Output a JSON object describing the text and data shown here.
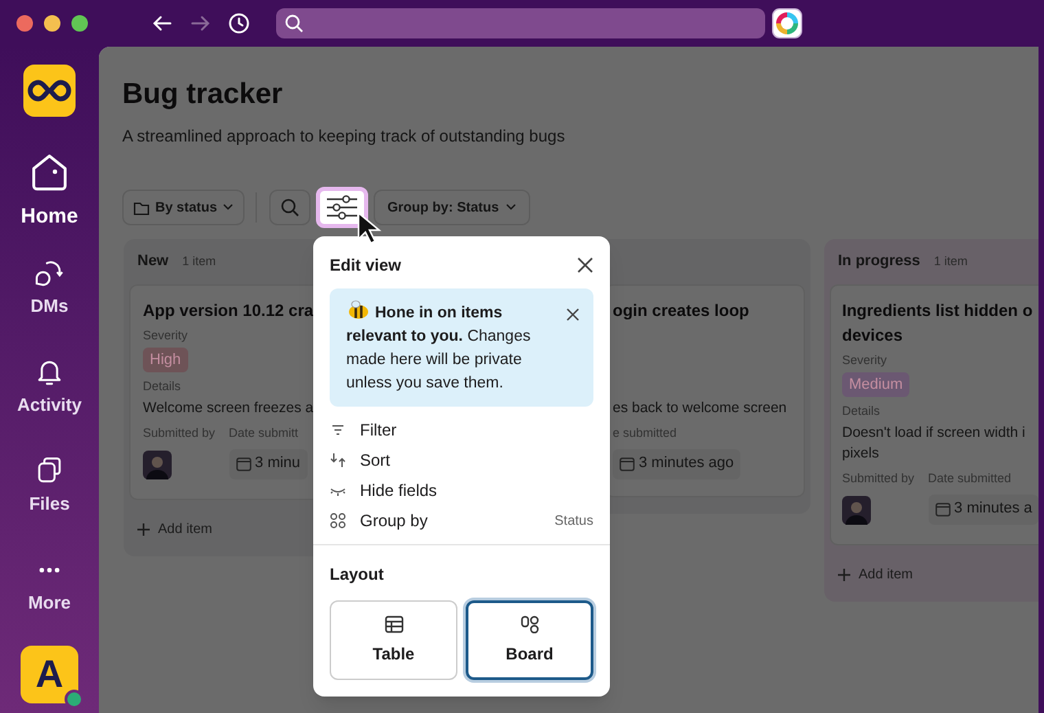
{
  "nav": [
    {
      "kind": "back",
      "disabled": false
    },
    {
      "kind": "forward",
      "disabled": true
    },
    {
      "kind": "history",
      "disabled": false
    }
  ],
  "sidebar": {
    "items": [
      {
        "kind": "home",
        "label": "Home",
        "selected": true
      },
      {
        "kind": "dms",
        "label": "DMs",
        "selected": false
      },
      {
        "kind": "activity",
        "label": "Activity",
        "selected": false
      },
      {
        "kind": "files",
        "label": "Files",
        "selected": false
      },
      {
        "kind": "more",
        "label": "More",
        "selected": false
      }
    ],
    "user_initial": "A",
    "online": true
  },
  "page": {
    "title": "Bug tracker",
    "description": "A streamlined approach to keeping track of outstanding bugs",
    "view_button": "By status",
    "group_button": "Group by: Status"
  },
  "columns": [
    {
      "name": "New",
      "count": "1 item",
      "add_label": "Add item",
      "cards": [
        {
          "title_lines": [
            "App version 10.12 cra"
          ],
          "severity_label": "Severity",
          "severity": {
            "label": "High",
            "color": "#6e5357"
          },
          "details_label": "Details",
          "details_lines": [
            "Welcome screen freezes a"
          ],
          "submitted_label": "Submitted by",
          "date_label": "Date submitt",
          "date": "3 minu"
        }
      ]
    },
    {
      "cards": [
        {
          "title_lines": [
            "ogin creates loop"
          ],
          "details_lines": [
            "es back to welcome screen"
          ],
          "date_label": "e submitted",
          "date": "3 minutes ago"
        }
      ]
    },
    {
      "name": "In progress",
      "count": "1 item",
      "add_label": "Add item",
      "cards": [
        {
          "title_lines": [
            "Ingredients list hidden o",
            "devices"
          ],
          "severity_label": "Severity",
          "severity": {
            "label": "Medium",
            "color": "#6b5872"
          },
          "details_label": "Details",
          "details_lines": [
            "Doesn't load if screen width i",
            "pixels"
          ],
          "submitted_label": "Submitted by",
          "date_label": "Date submitted",
          "date": "3 minutes a"
        }
      ]
    }
  ],
  "edit_view": {
    "title": "Edit view",
    "tip": "**Hone in on items relevant to you.** Changes made here will be private unless you save them.",
    "options": [
      {
        "kind": "filter",
        "label": "Filter"
      },
      {
        "kind": "sort",
        "label": "Sort"
      },
      {
        "kind": "hide",
        "label": "Hide fields"
      },
      {
        "kind": "group",
        "label": "Group by",
        "value": "Status"
      }
    ],
    "layout_label": "Layout",
    "layouts": [
      {
        "kind": "table",
        "label": "Table",
        "selected": false
      },
      {
        "kind": "board",
        "label": "Board",
        "selected": true
      }
    ]
  }
}
